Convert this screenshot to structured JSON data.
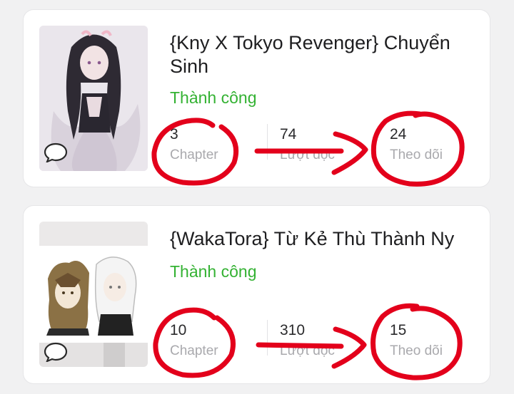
{
  "stories": [
    {
      "title": "{Kny X Tokyo Revenger} Chuyển Sinh",
      "status": "Thành công",
      "stats": [
        {
          "value": "3",
          "label": "Chapter"
        },
        {
          "value": "74",
          "label": "Lượt đọc"
        },
        {
          "value": "24",
          "label": "Theo dõi"
        }
      ],
      "cover_icon": "chat-bubble-icon"
    },
    {
      "title": "{WakaTora} Từ Kẻ Thù Thành Ny",
      "status": "Thành công",
      "stats": [
        {
          "value": "10",
          "label": "Chapter"
        },
        {
          "value": "310",
          "label": "Lượt đọc"
        },
        {
          "value": "15",
          "label": "Theo dõi"
        }
      ],
      "cover_icon": "chat-bubble-icon"
    }
  ],
  "colors": {
    "status_green": "#34b233",
    "annotation_red": "#e3001b",
    "background": "#f1f1f2"
  }
}
